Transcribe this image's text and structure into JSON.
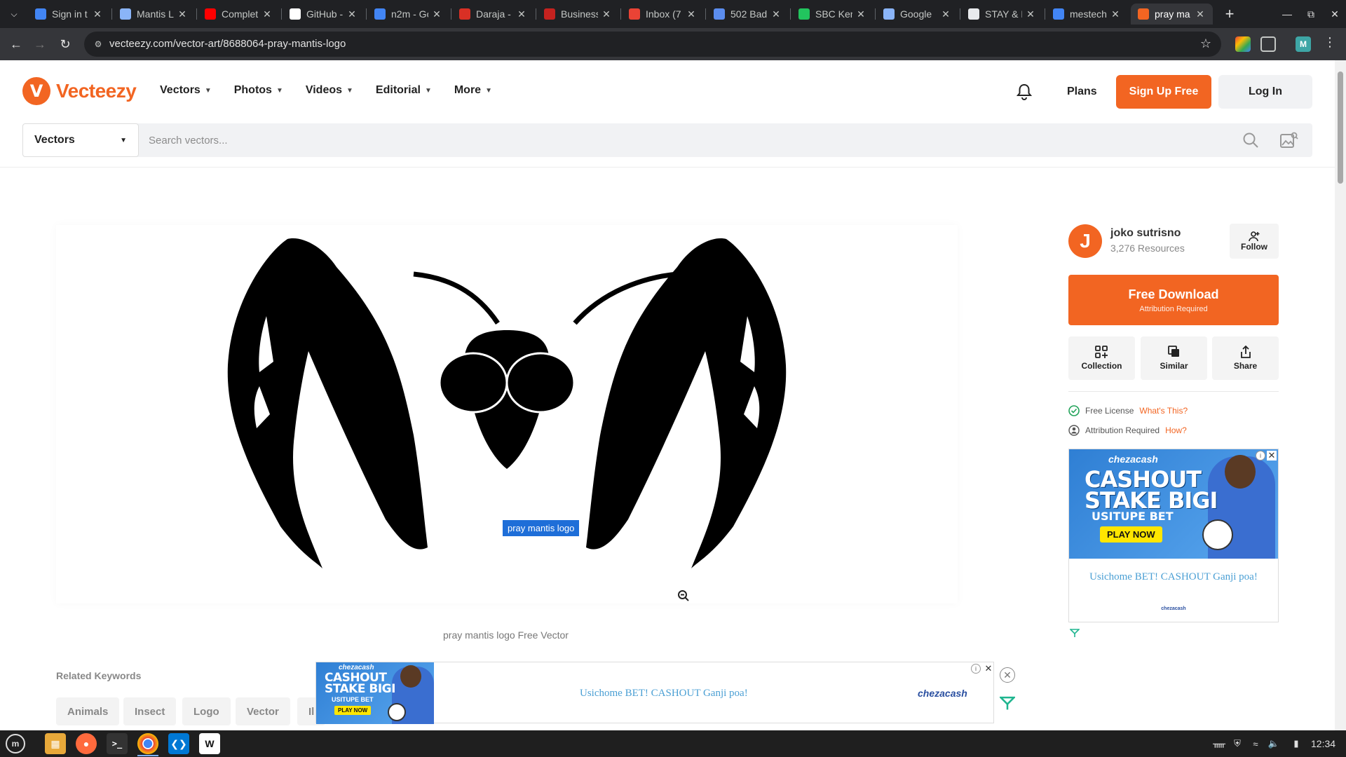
{
  "browser": {
    "tabs": [
      {
        "label": "Sign in t",
        "icon": "google-cloud-icon",
        "color": "#4285f4"
      },
      {
        "label": "Mantis L",
        "icon": "mantis-icon",
        "color": "#8ab4f8"
      },
      {
        "label": "Complet",
        "icon": "youtube-icon",
        "color": "#ff0000"
      },
      {
        "label": "GitHub -",
        "icon": "github-icon",
        "color": "#ffffff"
      },
      {
        "label": "n2m - Go",
        "icon": "google-icon",
        "color": "#4285f4"
      },
      {
        "label": "Daraja -",
        "icon": "daraja-icon",
        "color": "#d93025"
      },
      {
        "label": "Business",
        "icon": "business-icon",
        "color": "#c5221f"
      },
      {
        "label": "Inbox (7",
        "icon": "gmail-icon",
        "color": "#ea4335"
      },
      {
        "label": "502 Bad",
        "icon": "globe-icon",
        "color": "#5b8def"
      },
      {
        "label": "SBC Ken",
        "icon": "sbc-icon",
        "color": "#22c55e"
      },
      {
        "label": "Google",
        "icon": "gemini-icon",
        "color": "#8ab4f8"
      },
      {
        "label": "STAY & E",
        "icon": "doc-icon",
        "color": "#e8eaed"
      },
      {
        "label": "mestech",
        "icon": "google-icon",
        "color": "#4285f4"
      },
      {
        "label": "pray ma",
        "icon": "vecteezy-icon",
        "color": "#f26522",
        "active": true
      }
    ],
    "url": "vecteezy.com/vector-art/8688064-pray-mantis-logo"
  },
  "site": {
    "brand": "Vecteezy",
    "logo_letter": "V",
    "nav": [
      "Vectors",
      "Photos",
      "Videos",
      "Editorial",
      "More"
    ],
    "plans": "Plans",
    "signup": "Sign Up Free",
    "login": "Log In",
    "search_category": "Vectors",
    "search_placeholder": "Search vectors...",
    "accent": "#f26522"
  },
  "preview": {
    "tooltip": "pray mantis logo",
    "caption": "pray mantis logo Free Vector",
    "related_title": "Related Keywords",
    "keywords": [
      "Animals",
      "Insect",
      "Logo",
      "Vector",
      "Il"
    ]
  },
  "sidebar": {
    "avatar_letter": "J",
    "author": "joko sutrisno",
    "resources": "3,276 Resources",
    "follow": "Follow",
    "download_title": "Free Download",
    "download_sub": "Attribution Required",
    "actions": [
      "Collection",
      "Similar",
      "Share"
    ],
    "license": "Free License",
    "license_link": "What's This?",
    "attribution": "Attribution Required",
    "attribution_link": "How?"
  },
  "ads": {
    "brand": "chezacash",
    "headline_1": "CASHOUT",
    "headline_2": "STAKE BIGI",
    "subline": "USITUPE BET",
    "cta": "PLAY NOW",
    "tagline": "Usichome BET! CASHOUT Ganji poa!"
  },
  "taskbar": {
    "clock": "12:34"
  }
}
